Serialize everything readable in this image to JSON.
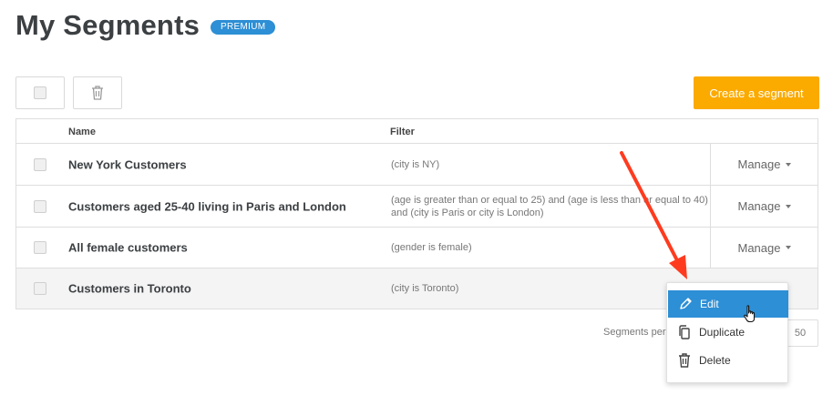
{
  "header": {
    "title": "My Segments",
    "badge": "PREMIUM"
  },
  "toolbar": {
    "create_label": "Create a segment"
  },
  "table": {
    "columns": [
      "Name",
      "Filter"
    ],
    "rows": [
      {
        "name": "New York Customers",
        "filter": "(city is NY)",
        "action": "Manage"
      },
      {
        "name": "Customers aged 25-40 living in Paris and London",
        "filter": "(age is greater than or equal to 25) and (age is less than or equal to 40) and (city is Paris or city is London)",
        "action": "Manage"
      },
      {
        "name": "All female customers",
        "filter": "(gender is female)",
        "action": "Manage"
      },
      {
        "name": "Customers in Toronto",
        "filter": "(city is Toronto)",
        "action": ""
      }
    ]
  },
  "pagination": {
    "label": "Segments per",
    "value": "50"
  },
  "context_menu": {
    "items": [
      {
        "label": "Edit",
        "icon": "pencil-icon",
        "active": true
      },
      {
        "label": "Duplicate",
        "icon": "copy-icon",
        "active": false
      },
      {
        "label": "Delete",
        "icon": "trash-icon",
        "active": false
      }
    ]
  },
  "colors": {
    "accent": "#2d8fd5",
    "create_button": "#fbaa00",
    "annotation_arrow": "#ff3b1f"
  }
}
